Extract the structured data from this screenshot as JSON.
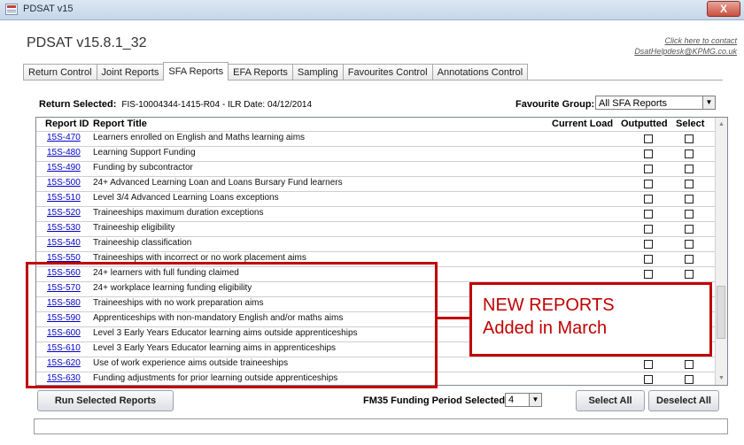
{
  "window": {
    "title": "PDSAT v15",
    "close_label": "X"
  },
  "app_title": "PDSAT v15.8.1_32",
  "contact": {
    "line1": "Click here to contact",
    "line2": "DsatHelpdesk@KPMG.co.uk"
  },
  "tabs": [
    {
      "label": "Return Control",
      "active": false
    },
    {
      "label": "Joint Reports",
      "active": false
    },
    {
      "label": "SFA Reports",
      "active": true
    },
    {
      "label": "EFA Reports",
      "active": false
    },
    {
      "label": "Sampling",
      "active": false
    },
    {
      "label": "Favourites Control",
      "active": false
    },
    {
      "label": "Annotations Control",
      "active": false
    }
  ],
  "return_selected": {
    "label": "Return Selected:",
    "value": "FIS-10004344-1415-R04 - ILR Date: 04/12/2014"
  },
  "favourite_group": {
    "label": "Favourite Group:",
    "value": "All SFA Reports"
  },
  "table": {
    "headers": {
      "id": "Report ID",
      "title": "Report Title",
      "current_load": "Current Load",
      "outputted": "Outputted",
      "select": "Select"
    },
    "rows": [
      {
        "id": "15S-470",
        "title": "Learners enrolled on English and Maths learning aims"
      },
      {
        "id": "15S-480",
        "title": "Learning Support Funding"
      },
      {
        "id": "15S-490",
        "title": "Funding by subcontractor"
      },
      {
        "id": "15S-500",
        "title": "24+ Advanced Learning Loan and Loans Bursary Fund learners"
      },
      {
        "id": "15S-510",
        "title": "Level 3/4 Advanced Learning Loans exceptions"
      },
      {
        "id": "15S-520",
        "title": "Traineeships maximum duration exceptions"
      },
      {
        "id": "15S-530",
        "title": "Traineeship eligibility"
      },
      {
        "id": "15S-540",
        "title": "Traineeship classification"
      },
      {
        "id": "15S-550",
        "title": "Traineeships with incorrect or no work placement aims"
      },
      {
        "id": "15S-560",
        "title": "24+ learners with full funding claimed"
      },
      {
        "id": "15S-570",
        "title": "24+ workplace learning funding eligibility"
      },
      {
        "id": "15S-580",
        "title": "Traineeships with no work preparation aims"
      },
      {
        "id": "15S-590",
        "title": "Apprenticeships with non-mandatory English and/or maths aims"
      },
      {
        "id": "15S-600",
        "title": "Level 3 Early Years Educator learning aims outside apprenticeships"
      },
      {
        "id": "15S-610",
        "title": "Level 3 Early Years Educator learning aims in apprenticeships"
      },
      {
        "id": "15S-620",
        "title": "Use of work experience aims outside traineeships"
      },
      {
        "id": "15S-630",
        "title": "Funding adjustments for prior learning outside apprenticeships"
      }
    ]
  },
  "callout": {
    "line1": "NEW REPORTS",
    "line2": "Added in March",
    "color": "#c00000"
  },
  "buttons": {
    "run": "Run Selected Reports",
    "select_all": "Select All",
    "deselect_all": "Deselect All"
  },
  "fm35": {
    "label": "FM35 Funding Period Selected:",
    "value": "4"
  }
}
